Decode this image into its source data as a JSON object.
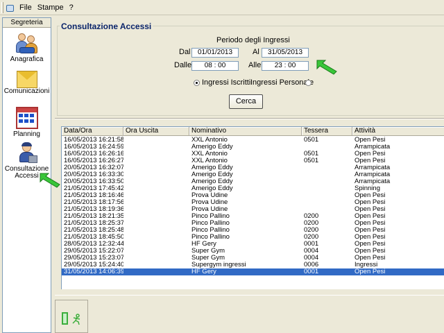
{
  "menubar": {
    "items": [
      "File",
      "Stampe",
      "?"
    ]
  },
  "sidebar": {
    "header": "Segreteria",
    "items": [
      {
        "label": "Anagrafica",
        "icon": "people-icon"
      },
      {
        "label": "Comunicazioni",
        "icon": "envelope-icon"
      },
      {
        "label": "Planning",
        "icon": "calendar-icon"
      },
      {
        "label_line1": "Consultazione",
        "label_line2": "Accessi",
        "icon": "access-control-icon"
      }
    ]
  },
  "search": {
    "title": "Consultazione Accessi",
    "period_label": "Periodo degli Ingressi",
    "dal_label": "Dal",
    "dal_value": "01/01/2013",
    "al_label": "Al",
    "al_value": "31/05/2013",
    "dalle_label": "Dalle",
    "dalle_value": "08 : 00",
    "alle_label": "Alle",
    "alle_value": "23 : 00",
    "radio_iscritti": "Ingressi Iscritti",
    "radio_personale": "Ingressi Personale",
    "search_button": "Cerca"
  },
  "grid": {
    "columns": [
      "Data/Ora",
      "Ora Uscita",
      "Nominativo",
      "Tessera",
      "Attività"
    ],
    "rows": [
      [
        "16/05/2013 16:21:58",
        "",
        "XXL Antonio",
        "0501",
        "Open Pesi"
      ],
      [
        "16/05/2013 16:24:59",
        "",
        "Amerigo Eddy",
        "",
        "Arrampicata"
      ],
      [
        "16/05/2013 16:26:16",
        "",
        "XXL Antonio",
        "0501",
        "Open Pesi"
      ],
      [
        "16/05/2013 16:26:27",
        "",
        "XXL Antonio",
        "0501",
        "Open Pesi"
      ],
      [
        "20/05/2013 16:32:07",
        "",
        "Amerigo Eddy",
        "",
        "Arrampicata"
      ],
      [
        "20/05/2013 16:33:30",
        "",
        "Amerigo Eddy",
        "",
        "Arrampicata"
      ],
      [
        "20/05/2013 16:33:50",
        "",
        "Amerigo Eddy",
        "",
        "Arrampicata"
      ],
      [
        "21/05/2013 17:45:42",
        "",
        "Amerigo Eddy",
        "",
        "Spinning"
      ],
      [
        "21/05/2013 18:16:46",
        "",
        "Prova Udine",
        "",
        "Open Pesi"
      ],
      [
        "21/05/2013 18:17:56",
        "",
        "Prova Udine",
        "",
        "Open Pesi"
      ],
      [
        "21/05/2013 18:19:36",
        "",
        "Prova Udine",
        "",
        "Open Pesi"
      ],
      [
        "21/05/2013 18:21:35",
        "",
        "Pinco Pallino",
        "0200",
        "Open Pesi"
      ],
      [
        "21/05/2013 18:25:37",
        "",
        "Pinco Pallino",
        "0200",
        "Open Pesi"
      ],
      [
        "21/05/2013 18:25:48",
        "",
        "Pinco Pallino",
        "0200",
        "Open Pesi"
      ],
      [
        "21/05/2013 18:45:50",
        "",
        "Pinco Pallino",
        "0200",
        "Open Pesi"
      ],
      [
        "28/05/2013 12:32:44",
        "",
        "HF Gery",
        "0001",
        "Open Pesi"
      ],
      [
        "29/05/2013 15:22:07",
        "",
        "Super Gym",
        "0004",
        "Open Pesi"
      ],
      [
        "29/05/2013 15:23:07",
        "",
        "Super Gym",
        "0004",
        "Open Pesi"
      ],
      [
        "29/05/2013 15:24:40",
        "",
        "Supergym ingressi",
        "0006",
        "Ingressi"
      ],
      [
        "31/05/2013 14:06:39",
        "",
        "HF Gery",
        "0001",
        "Open Pesi"
      ]
    ],
    "selected_row": 19
  },
  "colors": {
    "accent_title": "#0a246a",
    "selection": "#316ac5",
    "arrow": "#39c639"
  },
  "bottom": {
    "exit_icon": "exit-door-icon"
  }
}
